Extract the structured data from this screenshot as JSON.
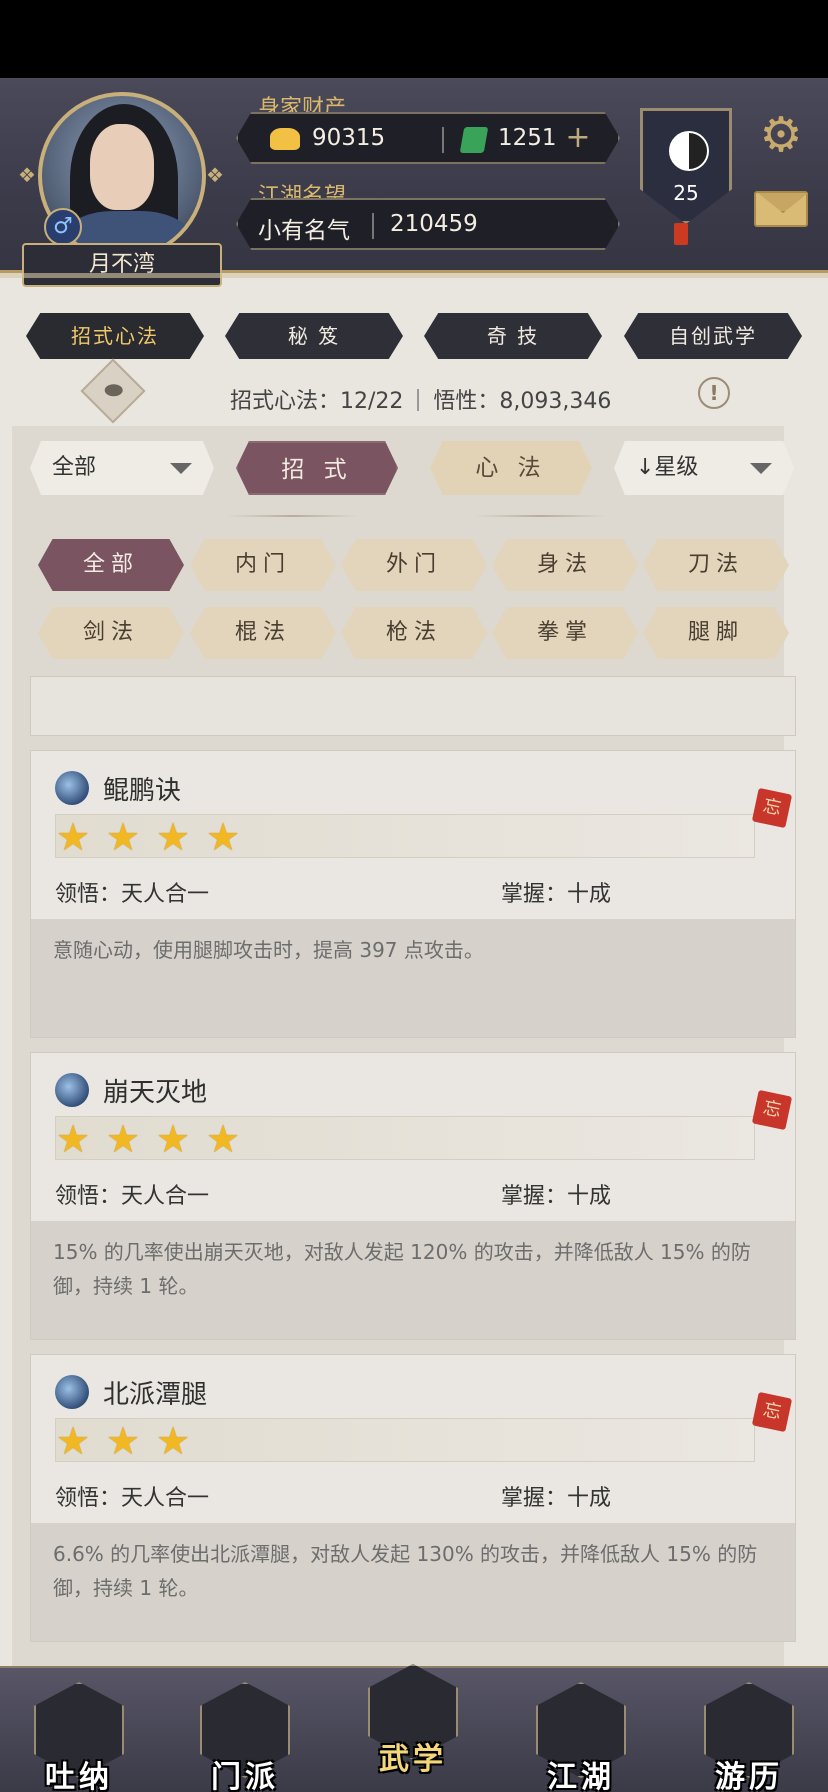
{
  "player": {
    "name": "月不湾",
    "gender_symbol": "♂"
  },
  "wealth": {
    "label": "身家财产",
    "gold": "90315",
    "jade": "1251"
  },
  "reputation": {
    "label": "江湖名望",
    "title": "小有名气",
    "value": "210459"
  },
  "level": "25",
  "category_tabs": [
    "招式心法",
    "秘 笈",
    "奇 技",
    "自创武学"
  ],
  "stats": {
    "skills_label": "招式心法：12/22",
    "insight_label": "悟性：8,093,346"
  },
  "filters": {
    "scope": "全部",
    "type_active": "招 式",
    "type_other": "心 法",
    "sort": "↓星级"
  },
  "chips_row1": [
    "全部",
    "内门",
    "外门",
    "身法",
    "刀法"
  ],
  "chips_row2": [
    "剑法",
    "棍法",
    "枪法",
    "拳掌",
    "腿脚"
  ],
  "skills": [
    {
      "name": "鲲鹏诀",
      "stars": 4,
      "insight": "领悟：天人合一",
      "mastery": "掌握：十成",
      "desc": "意随心动，使用腿脚攻击时，提高 397 点攻击。",
      "forget": "忘"
    },
    {
      "name": "崩天灭地",
      "stars": 4,
      "insight": "领悟：天人合一",
      "mastery": "掌握：十成",
      "desc": "15% 的几率使出崩天灭地，对敌人发起 120% 的攻击，并降低敌人 15% 的防御，持续 1 轮。",
      "forget": "忘"
    },
    {
      "name": "北派潭腿",
      "stars": 3,
      "insight": "领悟：天人合一",
      "mastery": "掌握：十成",
      "desc": "6.6% 的几率使出北派潭腿，对敌人发起 130% 的攻击，并降低敌人 15% 的防御，持续 1 轮。",
      "forget": "忘"
    }
  ],
  "nav": [
    "吐纳",
    "门派",
    "武学",
    "江湖",
    "游历"
  ]
}
